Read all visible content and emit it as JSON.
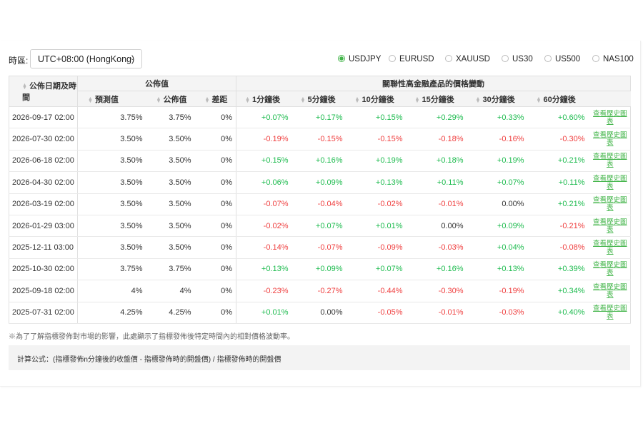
{
  "timezone": {
    "label": "時區:",
    "value": "UTC+08:00 (HongKong)"
  },
  "instruments": [
    {
      "label": "USDJPY",
      "selected": true
    },
    {
      "label": "EURUSD",
      "selected": false
    },
    {
      "label": "XAUUSD",
      "selected": false
    },
    {
      "label": "US30",
      "selected": false
    },
    {
      "label": "US500",
      "selected": false
    },
    {
      "label": "NAS100",
      "selected": false
    }
  ],
  "table": {
    "group_headers": {
      "date": "公佈日期及時間",
      "published": "公佈值",
      "movement": "關聯性高金融產品的價格變動"
    },
    "sub_headers": {
      "forecast": "預測值",
      "actual": "公佈值",
      "diff": "差距",
      "m1": "1分鐘後",
      "m5": "5分鐘後",
      "m10": "10分鐘後",
      "m15": "15分鐘後",
      "m30": "30分鐘後",
      "m60": "60分鐘後"
    },
    "history_link": "查看歷史圖表",
    "rows": [
      {
        "date": "2026-09-17 02:00",
        "forecast": "3.75%",
        "actual": "3.75%",
        "diff": "0%",
        "m1": "+0.07%",
        "m5": "+0.17%",
        "m10": "+0.15%",
        "m15": "+0.29%",
        "m30": "+0.33%",
        "m60": "+0.60%"
      },
      {
        "date": "2026-07-30 02:00",
        "forecast": "3.50%",
        "actual": "3.50%",
        "diff": "0%",
        "m1": "-0.19%",
        "m5": "-0.15%",
        "m10": "-0.15%",
        "m15": "-0.18%",
        "m30": "-0.16%",
        "m60": "-0.30%"
      },
      {
        "date": "2026-06-18 02:00",
        "forecast": "3.50%",
        "actual": "3.50%",
        "diff": "0%",
        "m1": "+0.15%",
        "m5": "+0.16%",
        "m10": "+0.19%",
        "m15": "+0.18%",
        "m30": "+0.19%",
        "m60": "+0.21%"
      },
      {
        "date": "2026-04-30 02:00",
        "forecast": "3.50%",
        "actual": "3.50%",
        "diff": "0%",
        "m1": "+0.06%",
        "m5": "+0.09%",
        "m10": "+0.13%",
        "m15": "+0.11%",
        "m30": "+0.07%",
        "m60": "+0.11%"
      },
      {
        "date": "2026-03-19 02:00",
        "forecast": "3.50%",
        "actual": "3.50%",
        "diff": "0%",
        "m1": "-0.07%",
        "m5": "-0.04%",
        "m10": "-0.02%",
        "m15": "-0.01%",
        "m30": "0.00%",
        "m60": "+0.21%"
      },
      {
        "date": "2026-01-29 03:00",
        "forecast": "3.50%",
        "actual": "3.50%",
        "diff": "0%",
        "m1": "-0.02%",
        "m5": "+0.07%",
        "m10": "+0.01%",
        "m15": "0.00%",
        "m30": "+0.09%",
        "m60": "-0.21%"
      },
      {
        "date": "2025-12-11 03:00",
        "forecast": "3.50%",
        "actual": "3.50%",
        "diff": "0%",
        "m1": "-0.14%",
        "m5": "-0.07%",
        "m10": "-0.09%",
        "m15": "-0.03%",
        "m30": "+0.04%",
        "m60": "-0.08%"
      },
      {
        "date": "2025-10-30 02:00",
        "forecast": "3.75%",
        "actual": "3.75%",
        "diff": "0%",
        "m1": "+0.13%",
        "m5": "+0.09%",
        "m10": "+0.07%",
        "m15": "+0.16%",
        "m30": "+0.13%",
        "m60": "+0.39%"
      },
      {
        "date": "2025-09-18 02:00",
        "forecast": "4%",
        "actual": "4%",
        "diff": "0%",
        "m1": "-0.23%",
        "m5": "-0.27%",
        "m10": "-0.44%",
        "m15": "-0.30%",
        "m30": "-0.19%",
        "m60": "+0.34%"
      },
      {
        "date": "2025-07-31 02:00",
        "forecast": "4.25%",
        "actual": "4.25%",
        "diff": "0%",
        "m1": "+0.01%",
        "m5": "0.00%",
        "m10": "-0.05%",
        "m15": "-0.01%",
        "m30": "-0.03%",
        "m60": "+0.40%"
      }
    ]
  },
  "footnote": "※為了了解指標發佈對市場的影響，此處顯示了指標發佈後特定時間內的相對價格波動率。",
  "formula": "計算公式：(指標發佈n分鐘後的收盤價 - 指標發佈時的開盤價) / 指標發佈時的開盤價",
  "colors": {
    "positive": "#1dbb4e",
    "negative": "#ef3e3e",
    "accent": "#43b54a"
  }
}
